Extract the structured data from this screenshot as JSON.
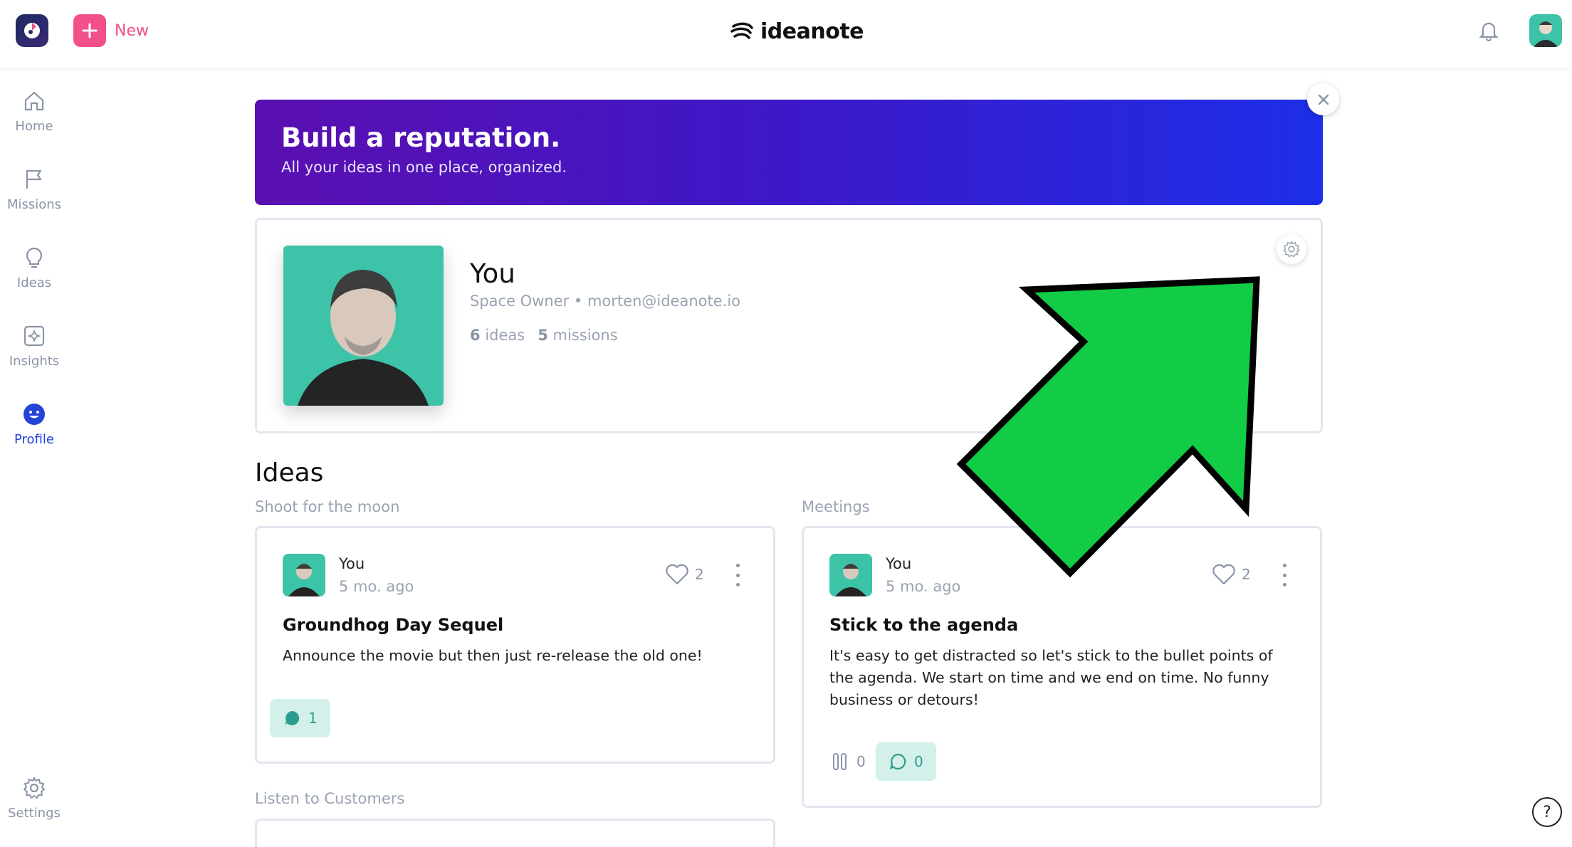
{
  "topbar": {
    "new_label": "New",
    "brand_name": "ideanote"
  },
  "sidebar": {
    "items": [
      {
        "label": "Home",
        "icon": "home-icon"
      },
      {
        "label": "Missions",
        "icon": "flag-icon"
      },
      {
        "label": "Ideas",
        "icon": "lightbulb-icon"
      },
      {
        "label": "Insights",
        "icon": "insights-icon"
      },
      {
        "label": "Profile",
        "icon": "smiley-icon",
        "active": true
      }
    ],
    "settings_label": "Settings"
  },
  "banner": {
    "title": "Build a reputation.",
    "subtitle": "All your ideas in one place, organized."
  },
  "profile": {
    "name": "You",
    "meta": "Space Owner • morten@ideanote.io",
    "ideas_count": "6",
    "ideas_label": "ideas",
    "missions_count": "5",
    "missions_label": "missions"
  },
  "ideas": {
    "section_title": "Ideas",
    "groups": [
      {
        "label": "Shoot for the moon",
        "card": {
          "author": "You",
          "time": "5 mo. ago",
          "likes": "2",
          "title": "Groundhog Day Sequel",
          "body": "Announce the movie but then just re-release the old one!",
          "comments": "1"
        }
      },
      {
        "label": "Meetings",
        "card": {
          "author": "You",
          "time": "5 mo. ago",
          "likes": "2",
          "title": "Stick to the agenda",
          "body": "It's easy to get distracted so let's stick to the bullet points of the agenda. We start on time and we end on time. No funny business or detours!",
          "votes": "0",
          "comments": "0"
        }
      },
      {
        "label": "Listen to Customers"
      }
    ]
  },
  "colors": {
    "accent_pink": "#f2508a",
    "accent_blue": "#2543d6",
    "teal": "#3cc3a8",
    "arrow_green": "#11cc44"
  },
  "help_label": "?"
}
